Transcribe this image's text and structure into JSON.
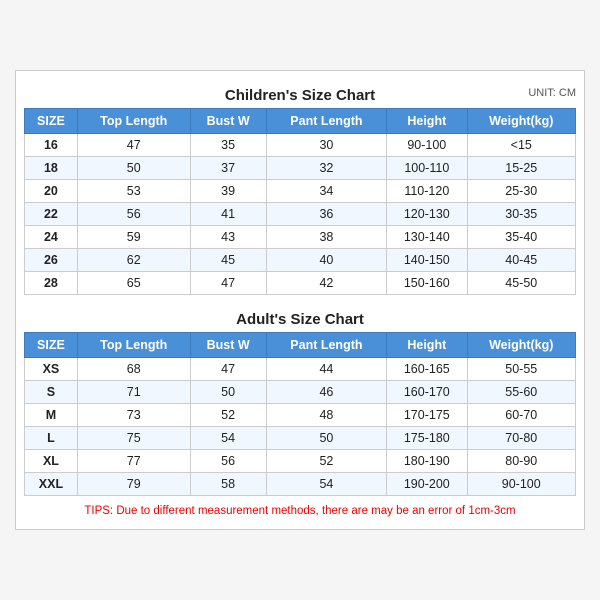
{
  "children_section": {
    "title": "Children's Size Chart",
    "unit": "UNIT: CM",
    "headers": [
      "SIZE",
      "Top Length",
      "Bust W",
      "Pant Length",
      "Height",
      "Weight(kg)"
    ],
    "rows": [
      [
        "16",
        "47",
        "35",
        "30",
        "90-100",
        "<15"
      ],
      [
        "18",
        "50",
        "37",
        "32",
        "100-110",
        "15-25"
      ],
      [
        "20",
        "53",
        "39",
        "34",
        "110-120",
        "25-30"
      ],
      [
        "22",
        "56",
        "41",
        "36",
        "120-130",
        "30-35"
      ],
      [
        "24",
        "59",
        "43",
        "38",
        "130-140",
        "35-40"
      ],
      [
        "26",
        "62",
        "45",
        "40",
        "140-150",
        "40-45"
      ],
      [
        "28",
        "65",
        "47",
        "42",
        "150-160",
        "45-50"
      ]
    ]
  },
  "adults_section": {
    "title": "Adult's Size Chart",
    "headers": [
      "SIZE",
      "Top Length",
      "Bust W",
      "Pant Length",
      "Height",
      "Weight(kg)"
    ],
    "rows": [
      [
        "XS",
        "68",
        "47",
        "44",
        "160-165",
        "50-55"
      ],
      [
        "S",
        "71",
        "50",
        "46",
        "160-170",
        "55-60"
      ],
      [
        "M",
        "73",
        "52",
        "48",
        "170-175",
        "60-70"
      ],
      [
        "L",
        "75",
        "54",
        "50",
        "175-180",
        "70-80"
      ],
      [
        "XL",
        "77",
        "56",
        "52",
        "180-190",
        "80-90"
      ],
      [
        "XXL",
        "79",
        "58",
        "54",
        "190-200",
        "90-100"
      ]
    ]
  },
  "tips": "TIPS: Due to different measurement methods, there are may be an error of 1cm-3cm"
}
